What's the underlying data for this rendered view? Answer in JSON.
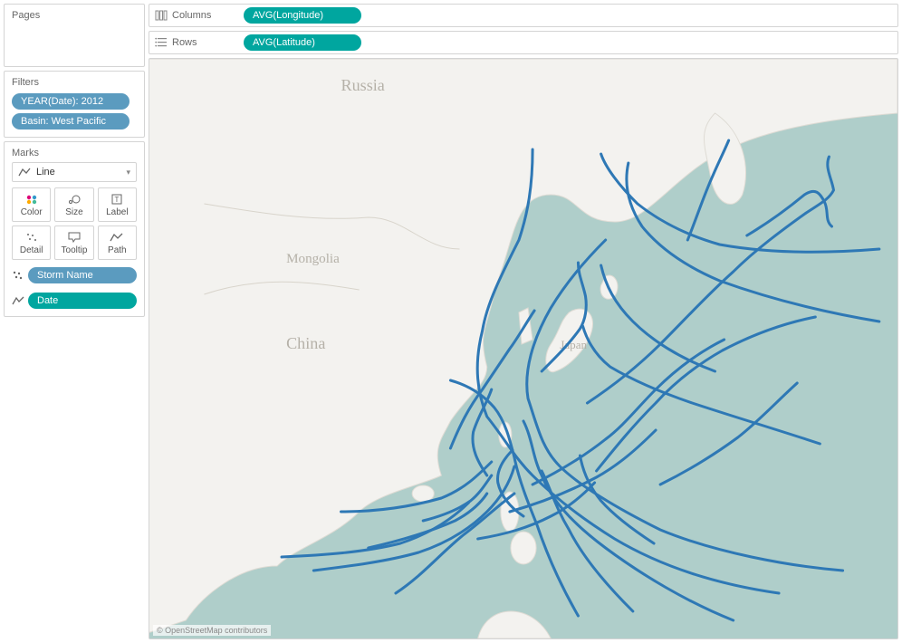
{
  "pages": {
    "title": "Pages"
  },
  "filters": {
    "title": "Filters",
    "items": [
      {
        "label": "YEAR(Date): 2012"
      },
      {
        "label": "Basin: West Pacific"
      }
    ]
  },
  "marks": {
    "title": "Marks",
    "type": "Line",
    "buttons": [
      "Color",
      "Size",
      "Label",
      "Detail",
      "Tooltip",
      "Path"
    ],
    "assigned": [
      {
        "kind": "detail",
        "label": "Storm Name",
        "color": "blue"
      },
      {
        "kind": "path",
        "label": "Date",
        "color": "green"
      }
    ]
  },
  "shelves": {
    "columns": {
      "label": "Columns",
      "pill": "AVG(Longitude)"
    },
    "rows": {
      "label": "Rows",
      "pill": "AVG(Latitude)"
    }
  },
  "map": {
    "attribution": "© OpenStreetMap contributors",
    "labels": {
      "russia": "Russia",
      "mongolia": "Mongolia",
      "china": "China",
      "japan": "Japan"
    }
  }
}
